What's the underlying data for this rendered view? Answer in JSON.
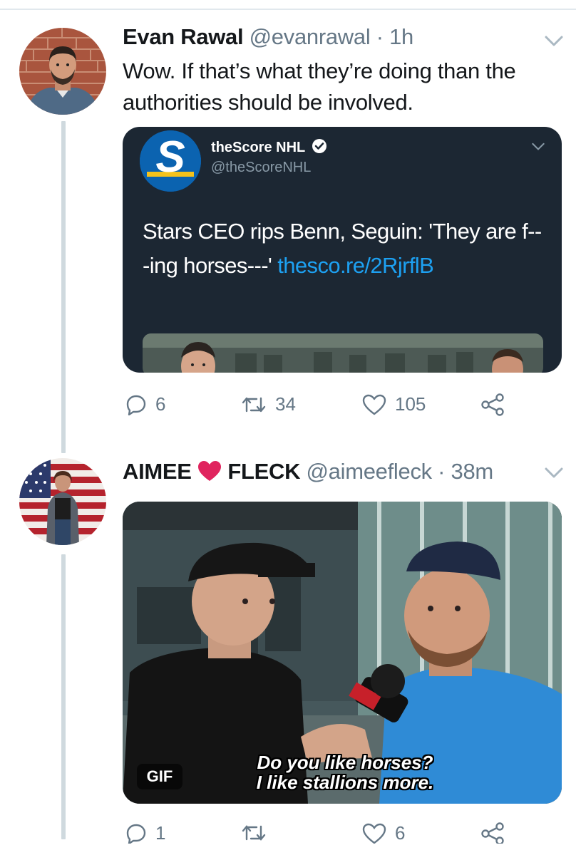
{
  "tweets": [
    {
      "name": "Evan Rawal",
      "handle": "@evanrawal",
      "separator": "·",
      "time": "1h",
      "text": "Wow. If that’s what they’re doing than the authorities should be involved.",
      "quote": {
        "name": "theScore NHL",
        "handle": "@theScoreNHL",
        "text": "Stars CEO rips Benn, Seguin: 'They are f---ing horses---' ",
        "link": "thesco.re/2RjrflB"
      },
      "replies": "6",
      "retweets": "34",
      "likes": "105"
    },
    {
      "name_part1": "AIMEE",
      "name_part2": "FLECK",
      "handle": "@aimeefleck",
      "separator": "·",
      "time": "38m",
      "media": {
        "badge": "GIF",
        "caption_line1": "Do you like horses?",
        "caption_line2": "I like stallions more."
      },
      "replies": "1",
      "likes": "6"
    }
  ],
  "icons": {
    "reply": "reply-icon",
    "retweet": "retweet-icon",
    "like": "heart-icon",
    "share": "share-icon",
    "verified": "verified-badge-icon",
    "menu": "chevron-down-icon",
    "emoji": "red-heart-icon"
  },
  "colors": {
    "text": "#14171a",
    "secondary": "#657786",
    "link": "#1da1f2",
    "card_bg": "#1c2733",
    "heart": "#e0245e"
  }
}
